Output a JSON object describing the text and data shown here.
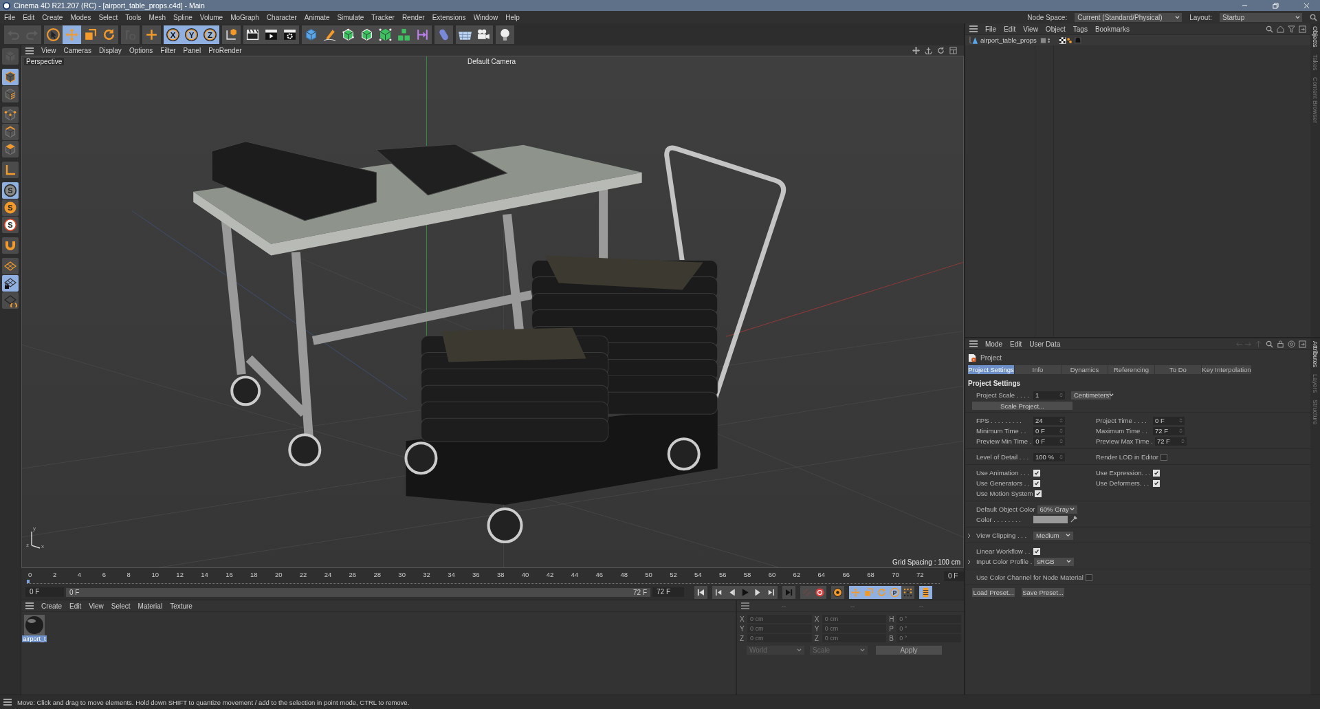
{
  "window": {
    "title": "Cinema 4D R21.207 (RC) - [airport_table_props.c4d] - Main"
  },
  "menu_bar": [
    "File",
    "Edit",
    "Create",
    "Modes",
    "Select",
    "Tools",
    "Mesh",
    "Spline",
    "Volume",
    "MoGraph",
    "Character",
    "Animate",
    "Simulate",
    "Tracker",
    "Render",
    "Extensions",
    "Window",
    "Help"
  ],
  "node_space": {
    "label": "Node Space:",
    "value": "Current (Standard/Physical)"
  },
  "layout": {
    "label": "Layout:",
    "value": "Startup"
  },
  "toolbar": [
    [
      {
        "kind": "undo",
        "selected": false,
        "disabled": true
      },
      {
        "kind": "redo",
        "selected": false,
        "disabled": true
      }
    ],
    [
      {
        "kind": "select",
        "selected": false,
        "disabled": false
      },
      {
        "kind": "move",
        "selected": true,
        "disabled": false
      },
      {
        "kind": "scale",
        "selected": false,
        "disabled": false
      },
      {
        "kind": "rotate",
        "selected": false,
        "disabled": false
      }
    ],
    [
      {
        "kind": "recent",
        "selected": false,
        "disabled": true
      }
    ],
    [
      {
        "kind": "add",
        "selected": false,
        "disabled": false
      }
    ],
    [
      {
        "kind": "axis",
        "label": "X",
        "selected": true,
        "disabled": false
      },
      {
        "kind": "axis",
        "label": "Y",
        "selected": true,
        "disabled": false
      },
      {
        "kind": "axis",
        "label": "Z",
        "selected": true,
        "disabled": false
      }
    ],
    [
      {
        "kind": "coord",
        "selected": false,
        "disabled": false
      }
    ],
    [
      {
        "kind": "clapper",
        "selected": false,
        "disabled": false
      },
      {
        "kind": "render",
        "selected": false,
        "disabled": false
      },
      {
        "kind": "render-settings",
        "selected": false,
        "disabled": false
      }
    ],
    [
      {
        "kind": "cube",
        "selected": false,
        "disabled": false
      },
      {
        "kind": "pen",
        "selected": false,
        "disabled": false
      },
      {
        "kind": "subdiv",
        "selected": false,
        "disabled": false
      },
      {
        "kind": "extrude",
        "selected": false,
        "disabled": false
      },
      {
        "kind": "cloner",
        "selected": false,
        "disabled": false
      },
      {
        "kind": "array",
        "selected": false,
        "disabled": false
      },
      {
        "kind": "deformer",
        "selected": false,
        "disabled": false
      }
    ],
    [
      {
        "kind": "tag",
        "selected": false,
        "disabled": false
      }
    ],
    [
      {
        "kind": "floor",
        "selected": false,
        "disabled": false
      },
      {
        "kind": "camera",
        "selected": false,
        "disabled": false
      }
    ],
    [
      {
        "kind": "light",
        "selected": false,
        "disabled": false
      }
    ]
  ],
  "left_tools": [
    [
      {
        "kind": "model",
        "selected": false,
        "disabled": true
      }
    ],
    [
      {
        "kind": "object",
        "selected": true,
        "disabled": false
      },
      {
        "kind": "texture",
        "selected": false,
        "disabled": false
      }
    ],
    [
      {
        "kind": "points",
        "selected": false,
        "disabled": false
      },
      {
        "kind": "edges",
        "selected": false,
        "disabled": false
      },
      {
        "kind": "polygons",
        "selected": false,
        "disabled": false
      }
    ],
    [
      {
        "kind": "axis-tool",
        "selected": false,
        "disabled": false
      }
    ],
    [
      {
        "kind": "snap",
        "label": "S",
        "selected": true,
        "disabled": false
      },
      {
        "kind": "snap-orange",
        "label": "S",
        "selected": false,
        "disabled": false
      },
      {
        "kind": "snap-white",
        "label": "S",
        "selected": false,
        "disabled": false
      }
    ],
    [
      {
        "kind": "magnet",
        "selected": false,
        "disabled": false
      }
    ],
    [
      {
        "kind": "workplane",
        "selected": false,
        "disabled": false
      },
      {
        "kind": "workplane-lock",
        "selected": true,
        "disabled": false
      },
      {
        "kind": "workplane-sync",
        "selected": false,
        "disabled": false
      }
    ]
  ],
  "viewport": {
    "menu": [
      "View",
      "Cameras",
      "Display",
      "Options",
      "Filter",
      "Panel",
      "ProRender"
    ],
    "view_name": "Perspective",
    "camera": "Default Camera",
    "grid_spacing": "Grid Spacing : 100 cm",
    "axis_labels": [
      "y",
      "z",
      "x"
    ]
  },
  "timeline": {
    "ticks": [
      "0",
      "2",
      "4",
      "6",
      "8",
      "10",
      "12",
      "14",
      "16",
      "18",
      "20",
      "22",
      "24",
      "26",
      "28",
      "30",
      "32",
      "34",
      "36",
      "38",
      "40",
      "42",
      "44",
      "46",
      "48",
      "50",
      "52",
      "54",
      "56",
      "58",
      "60",
      "62",
      "64",
      "66",
      "68",
      "70",
      "72"
    ],
    "current_frame": "0 F",
    "start": "0 F",
    "range": {
      "start": "0 F",
      "end": "72 F",
      "level": 1
    },
    "end": "72 F",
    "transport": [
      [
        {
          "kind": "goto-start",
          "selected": false,
          "disabled": false
        }
      ],
      [
        {
          "kind": "prev-key",
          "selected": false,
          "disabled": false
        },
        {
          "kind": "prev-frame",
          "selected": false,
          "disabled": false
        },
        {
          "kind": "play",
          "selected": false,
          "disabled": false
        },
        {
          "kind": "next-frame",
          "selected": false,
          "disabled": false
        },
        {
          "kind": "next-key",
          "selected": false,
          "disabled": false
        }
      ],
      [
        {
          "kind": "goto-end",
          "selected": false,
          "disabled": false
        }
      ],
      [
        {
          "kind": "record",
          "selected": false,
          "disabled": true
        },
        {
          "kind": "autokey",
          "selected": false,
          "disabled": false
        }
      ],
      [
        {
          "kind": "keyframe",
          "selected": false,
          "disabled": false
        }
      ],
      [
        {
          "kind": "move",
          "selected": true,
          "disabled": false
        },
        {
          "kind": "scale",
          "selected": true,
          "disabled": false
        },
        {
          "kind": "rotate",
          "selected": true,
          "disabled": false
        },
        {
          "kind": "param",
          "label": "P",
          "selected": true,
          "disabled": false
        },
        {
          "kind": "pla",
          "selected": false,
          "disabled": false
        }
      ],
      [
        {
          "kind": "film",
          "selected": true,
          "disabled": false
        }
      ]
    ]
  },
  "materials": {
    "menu": [
      "Create",
      "Edit",
      "View",
      "Select",
      "Material",
      "Texture"
    ],
    "items": [
      {
        "name": "airport_t",
        "selected": true
      }
    ]
  },
  "coordinates": {
    "headers": [
      "--",
      "--",
      "--"
    ],
    "columns": [
      [
        {
          "axis": "X",
          "placeholder": "0 cm"
        },
        {
          "axis": "Y",
          "placeholder": "0 cm"
        },
        {
          "axis": "Z",
          "placeholder": "0 cm"
        }
      ],
      [
        {
          "axis": "X",
          "placeholder": "0 cm"
        },
        {
          "axis": "Y",
          "placeholder": "0 cm"
        },
        {
          "axis": "Z",
          "placeholder": "0 cm"
        }
      ],
      [
        {
          "axis": "H",
          "placeholder": "0 °"
        },
        {
          "axis": "P",
          "placeholder": "0 °"
        },
        {
          "axis": "B",
          "placeholder": "0 °"
        }
      ]
    ],
    "space": "World",
    "mode": "Scale",
    "apply": "Apply"
  },
  "objects": {
    "menu": [
      "File",
      "Edit",
      "View",
      "Object",
      "Tags",
      "Bookmarks"
    ],
    "items": [
      {
        "name": "airport_table_props"
      }
    ],
    "side_tabs": [
      "Objects",
      "Takes",
      "Content Browser"
    ]
  },
  "attributes": {
    "menu": [
      "Mode",
      "Edit",
      "User Data"
    ],
    "object": "Project",
    "side_tabs": [
      "Attributes",
      "Layers",
      "Structure"
    ],
    "tabs": [
      {
        "label": "Project Settings",
        "selected": true
      },
      {
        "label": "Info",
        "selected": false
      },
      {
        "label": "Dynamics",
        "selected": false
      },
      {
        "label": "Referencing",
        "selected": false
      },
      {
        "label": "To Do",
        "selected": false
      },
      {
        "label": "Key Interpolation",
        "selected": false
      }
    ],
    "section": "Project Settings",
    "scale": {
      "label": "Project Scale . . . .",
      "value": "1",
      "unit": "Centimeters"
    },
    "scale_button": "Scale Project...",
    "groups": [
      [
        [
          {
            "kind": "field",
            "label": "FPS . . . . . . . . .",
            "value": "24"
          },
          {
            "kind": "field",
            "label": "Project Time . . . .",
            "value": "0 F"
          }
        ],
        [
          {
            "kind": "field",
            "label": "Minimum Time . .",
            "value": "0 F"
          },
          {
            "kind": "field",
            "label": "Maximum Time . .",
            "value": "72 F"
          }
        ],
        [
          {
            "kind": "field",
            "label": "Preview Min Time .",
            "value": "0 F"
          },
          {
            "kind": "field",
            "label": "Preview Max Time .",
            "value": "72 F"
          }
        ]
      ],
      [
        [
          {
            "kind": "field",
            "label": "Level of Detail . . .",
            "value": "100 %"
          },
          {
            "kind": "check",
            "label": "Render LOD in Editor",
            "checked": false
          }
        ]
      ],
      [
        [
          {
            "kind": "check",
            "label": "Use Animation . . .",
            "checked": true
          },
          {
            "kind": "check",
            "label": "Use Expression. . .",
            "checked": true
          }
        ],
        [
          {
            "kind": "check",
            "label": "Use Generators . .",
            "checked": true
          },
          {
            "kind": "check",
            "label": "Use Deformers. . .",
            "checked": true
          }
        ],
        [
          {
            "kind": "check",
            "label": "Use Motion System",
            "checked": true
          }
        ]
      ],
      [
        [
          {
            "kind": "dropdown",
            "label": "Default Object Color",
            "value": "60% Gray"
          }
        ],
        [
          {
            "kind": "color",
            "label": "Color . . . . . . . .",
            "color": "#9a9a9a"
          }
        ]
      ],
      [
        [
          {
            "kind": "expander",
            "label": "View Clipping . . .",
            "value": "Medium"
          }
        ]
      ],
      [
        [
          {
            "kind": "check",
            "label": "Linear Workflow . .",
            "checked": true
          }
        ],
        [
          {
            "kind": "expander",
            "label": "Input Color Profile .",
            "value": "sRGB"
          }
        ]
      ],
      [
        [
          {
            "kind": "check",
            "label": "Use Color Channel for Node Material",
            "checked": false
          }
        ]
      ]
    ],
    "presets": [
      "Load Preset...",
      "Save Preset..."
    ]
  },
  "status_bar": "Move: Click and drag to move elements. Hold down SHIFT to quantize movement / add to the selection in point mode, CTRL to remove."
}
